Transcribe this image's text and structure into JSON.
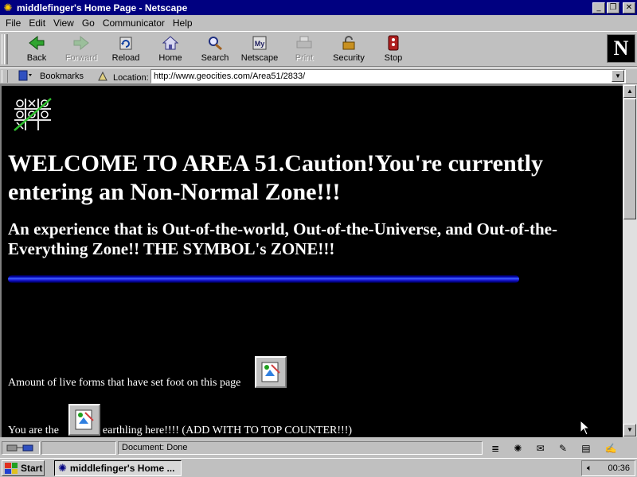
{
  "window": {
    "title": "middlefinger's Home Page - Netscape",
    "minimize": "_",
    "maximize": "❐",
    "close": "✕"
  },
  "menu": [
    "File",
    "Edit",
    "View",
    "Go",
    "Communicator",
    "Help"
  ],
  "toolbar": {
    "buttons": [
      {
        "label": "Back",
        "icon": "back-arrow-icon",
        "enabled": true
      },
      {
        "label": "Forward",
        "icon": "forward-arrow-icon",
        "enabled": false
      },
      {
        "label": "Reload",
        "icon": "reload-icon",
        "enabled": true
      },
      {
        "label": "Home",
        "icon": "home-icon",
        "enabled": true
      },
      {
        "label": "Search",
        "icon": "search-icon",
        "enabled": true
      },
      {
        "label": "Netscape",
        "icon": "netscape-icon",
        "enabled": true
      },
      {
        "label": "Print",
        "icon": "print-icon",
        "enabled": false
      },
      {
        "label": "Security",
        "icon": "security-lock-icon",
        "enabled": true
      },
      {
        "label": "Stop",
        "icon": "stop-icon",
        "enabled": true
      }
    ],
    "logo_letter": "N"
  },
  "location_bar": {
    "bookmarks_label": "Bookmarks",
    "location_label": "Location:",
    "url": "http://www.geocities.com/Area51/2833/"
  },
  "page": {
    "heading": "WELCOME TO AREA 51.Caution!You're currently entering an Non-Normal Zone!!!",
    "subheading": "An experience that is Out-of-the-world, Out-of-the-Universe, and Out-of-the-Everything Zone!! THE SYMBOL's ZONE!!!",
    "visitor_text": "Amount of live forms that have set foot on this page",
    "earthling_before": "You are the",
    "earthling_after": "earthling here!!!! (ADD WITH TO TOP COUNTER!!!)",
    "background_color": "#000000",
    "text_color": "#ffffff"
  },
  "status": {
    "text": "Document: Done"
  },
  "taskbar": {
    "start_label": "Start",
    "task_label": "middlefinger's Home ...",
    "clock": "00:36"
  }
}
